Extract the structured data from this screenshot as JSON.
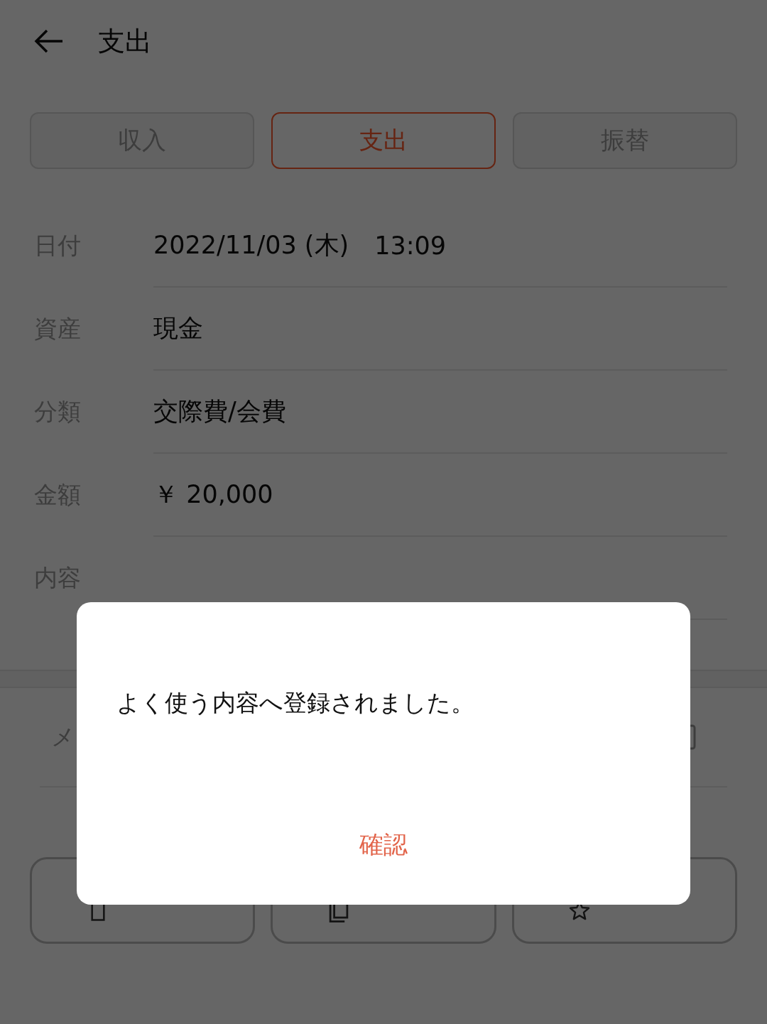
{
  "header": {
    "title": "支出"
  },
  "tabs": [
    {
      "label": "収入",
      "selected": false
    },
    {
      "label": "支出",
      "selected": true
    },
    {
      "label": "振替",
      "selected": false
    }
  ],
  "fields": [
    {
      "label": "日付",
      "value": "2022/11/03 (木)",
      "time": "13:09"
    },
    {
      "label": "資産",
      "value": "現金"
    },
    {
      "label": "分類",
      "value": "交際費/会費"
    },
    {
      "label": "金額",
      "value": "￥ 20,000"
    },
    {
      "label": "内容"
    }
  ],
  "memo": {
    "label": "メ"
  },
  "actions": [
    {
      "kind": "delete"
    },
    {
      "kind": "copy"
    },
    {
      "kind": "favorite"
    }
  ],
  "dialog": {
    "message": "よく使う内容へ登録されました。",
    "button": "確認"
  }
}
